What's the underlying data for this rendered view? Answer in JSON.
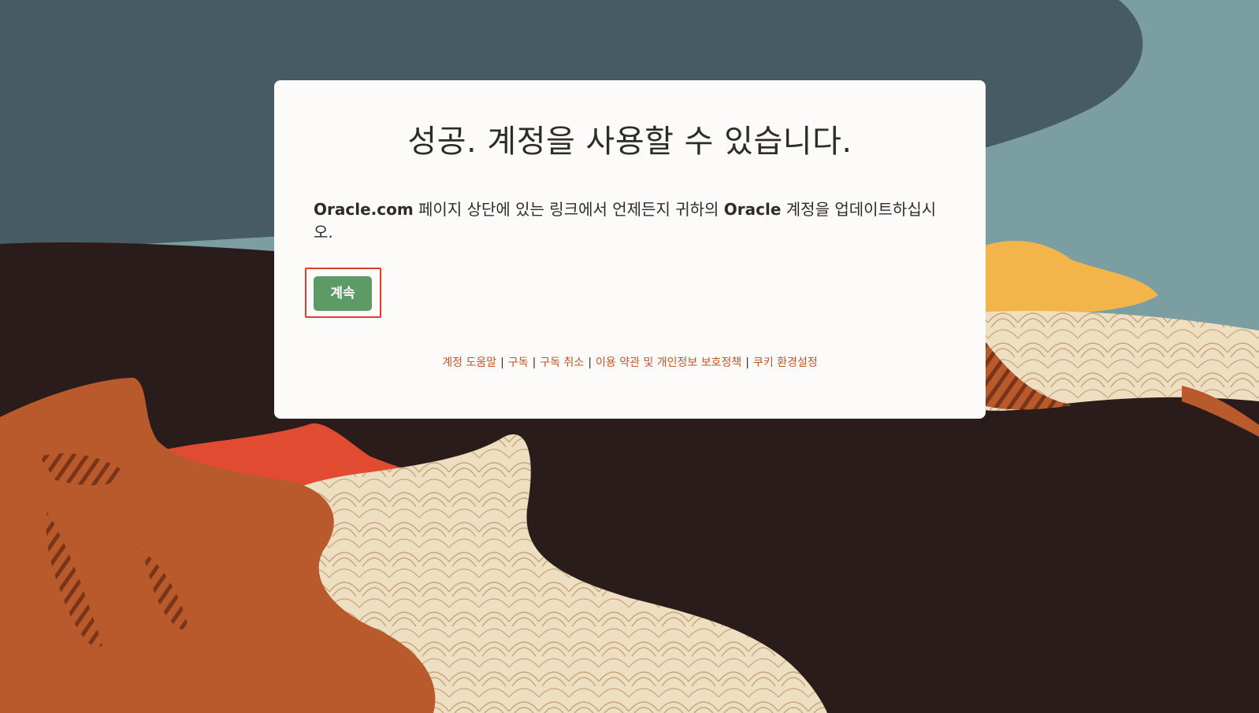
{
  "colors": {
    "sky_dark": "#475b62",
    "sky_light": "#7a9ea2",
    "ground_dark": "#2a1c1a",
    "orange": "#b85a2b",
    "red": "#e04b32",
    "cream": "#eedfc3",
    "yellow": "#f3b54a",
    "button_green": "#5d9a66",
    "link_orange": "#c0552a",
    "highlight_red": "#e23b2e"
  },
  "card": {
    "title": "성공. 계정을 사용할 수 있습니다.",
    "description": {
      "brand1": "Oracle.com",
      "part1": " 페이지 상단에 있는 링크에서 언제든지 귀하의 ",
      "brand2": "Oracle",
      "part2": " 계정을 업데이트하십시오."
    },
    "continue_label": "계속"
  },
  "footer": {
    "links": [
      "계정 도움말",
      "구독",
      "구독 취소",
      "이용 약관 및 개인정보 보호정책",
      "쿠키 환경설정"
    ],
    "separator": "|"
  }
}
